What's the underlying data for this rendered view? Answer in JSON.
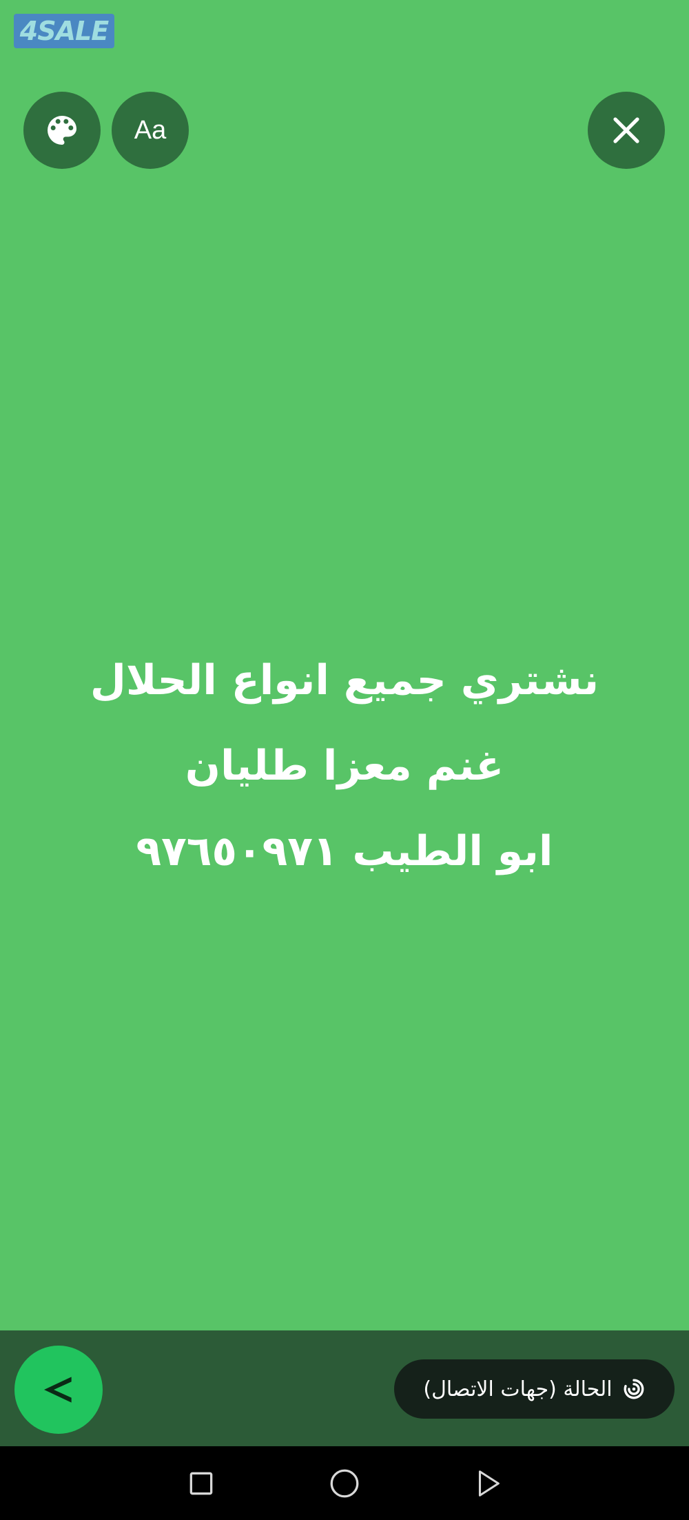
{
  "watermark": {
    "text": "4SALE"
  },
  "toolbar": {
    "palette_icon": "palette-icon",
    "font_label": "Aa",
    "close_icon": "close-icon"
  },
  "status": {
    "lines": [
      "نشتري جميع انواع الحلال",
      "غنم معزا طليان",
      "ابو الطيب ٩٧٦٥٠٩٧١"
    ],
    "background_color": "#58c467"
  },
  "bottom_bar": {
    "send_icon": "send-icon",
    "audience_label": "الحالة (جهات الاتصال)",
    "audience_icon": "status-icon"
  },
  "nav": {
    "recents_icon": "square-icon",
    "home_icon": "circle-icon",
    "back_icon": "triangle-icon"
  }
}
